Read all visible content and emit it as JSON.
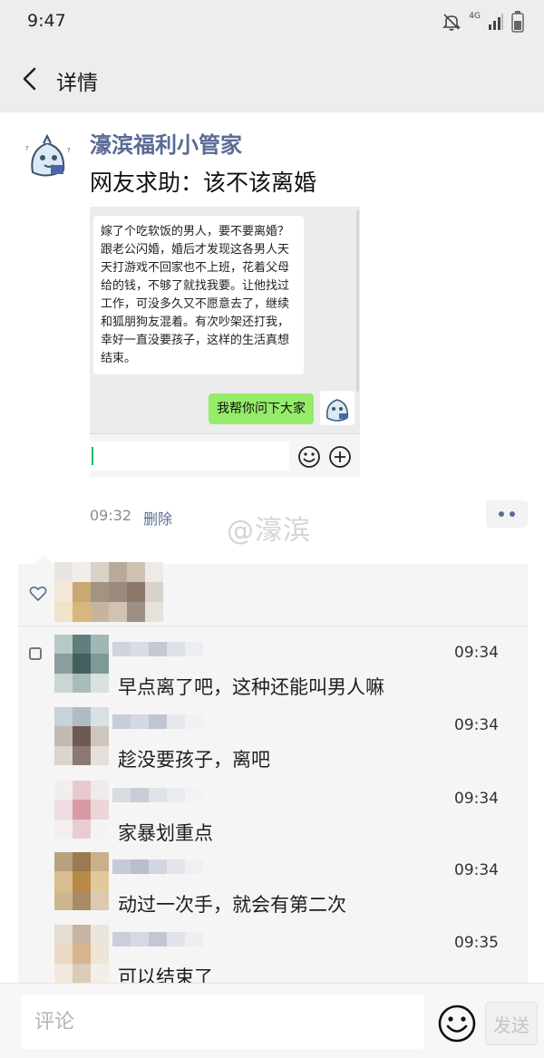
{
  "status_bar": {
    "time": "9:47",
    "network": "4G"
  },
  "title_bar": {
    "title": "详情"
  },
  "post": {
    "author": "濠滨福利小管家",
    "text": "网友求助：该不该离婚",
    "time": "09:32",
    "delete_label": "删除",
    "watermark": "@濠滨"
  },
  "screenshot": {
    "received_message": "嫁了个吃软饭的男人，要不要离婚？跟老公闪婚，婚后才发现这各男人天天打游戏不回家也不上班，花着父母给的钱，不够了就找我要。让他找过工作，可没多久又不愿意去了，继续和狐朋狗友混着。有次吵架还打我，幸好一直没要孩子，这样的生活真想结束。",
    "sent_message": "我帮你问下大家"
  },
  "comments": [
    {
      "time": "09:34",
      "text": "早点离了吧，这种还能叫男人嘛"
    },
    {
      "time": "09:34",
      "text": "趁没要孩子，离吧"
    },
    {
      "time": "09:34",
      "text": "家暴划重点"
    },
    {
      "time": "09:34",
      "text": "动过一次手，就会有第二次"
    },
    {
      "time": "09:35",
      "text": "可以结束了"
    }
  ],
  "bottom_bar": {
    "placeholder": "评论",
    "send_label": "发送"
  },
  "colors": {
    "link": "#5a6b95",
    "bubble_green": "#95ec69",
    "panel": "#f5f5f5"
  }
}
